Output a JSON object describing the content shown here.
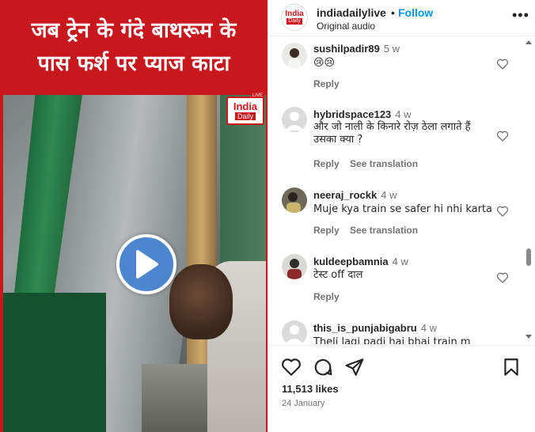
{
  "post": {
    "headline_line1": "जब ट्रेन के गंदे बाथरूम के",
    "headline_line2": "पास फर्श पर प्याज काटा",
    "watermark": {
      "line1": "India",
      "line2": "Daily",
      "live": "LIVE"
    },
    "header_bg_color": "#c8171d"
  },
  "header": {
    "username": "indiadailylive",
    "separator": "•",
    "follow_label": "Follow",
    "audio_label": "Original audio",
    "more_label": "•••",
    "avatar": {
      "line1": "India",
      "line2": "Daily"
    }
  },
  "comments": [
    {
      "username": "sushilpadir89",
      "time": "5 w",
      "text": "😢😢",
      "actions": [
        "Reply"
      ]
    },
    {
      "username": "hybridspace123",
      "time": "4 w",
      "text": "और जो नाली के किनारे रोज़ ठेला लगाते हैं उसका क्या ?",
      "actions": [
        "Reply",
        "See translation"
      ]
    },
    {
      "username": "neeraj_rockk",
      "time": "4 w",
      "text": "Muje kya train se safer hi nhi karta",
      "actions": [
        "Reply",
        "See translation"
      ]
    },
    {
      "username": "kuldeepbamnia",
      "time": "4 w",
      "text": "टेस्ट off दाल",
      "actions": [
        "Reply"
      ]
    },
    {
      "username": "this_is_punjabigabru",
      "time": "4 w",
      "text": "Theli lagi padi hai bhai train m",
      "actions": []
    }
  ],
  "footer": {
    "likes": "11,513 likes",
    "date": "24 January"
  },
  "colors": {
    "accent": "#0095f6",
    "brand_red": "#d0141b",
    "play_button": "#4b86cf"
  }
}
